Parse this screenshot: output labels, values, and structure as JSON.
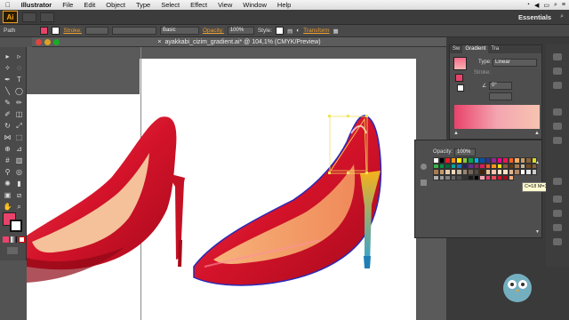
{
  "menubar": {
    "apple": "",
    "app_name": "Illustrator",
    "items": [
      "File",
      "Edit",
      "Object",
      "Type",
      "Select",
      "Effect",
      "View",
      "Window",
      "Help"
    ]
  },
  "appbar": {
    "logo": "Ai",
    "workspace": "Essentials"
  },
  "control": {
    "path_label": "Path",
    "stroke_label": "Stroke:",
    "stroke_style": "Basic",
    "opacity_label": "Opacity:",
    "opacity_value": "100%",
    "style_label": "Style:",
    "transform_label": "Transform"
  },
  "document": {
    "tab_title": "ayakkabi_cizim_gradient.ai* @ 104,1% (CMYK/Preview)"
  },
  "gradient_panel": {
    "tabs": [
      "Sw",
      "Gradient",
      "Tra"
    ],
    "type_label": "Type:",
    "type_value": "Linear",
    "stroke_label": "Stroke:",
    "angle_value": "0°"
  },
  "swatches_popup": {
    "opacity_label": "Opacity:",
    "opacity_value": "100%",
    "tooltip": "C=18 M=30 Y=37"
  },
  "colors": {
    "fill": "#e8436a",
    "accent": "#f0a030",
    "shoe_red": "#d81a2e",
    "shoe_inner": "#f3a36e",
    "heel_blue": "#2aa3d8",
    "heel_yellow": "#f6b21a"
  }
}
